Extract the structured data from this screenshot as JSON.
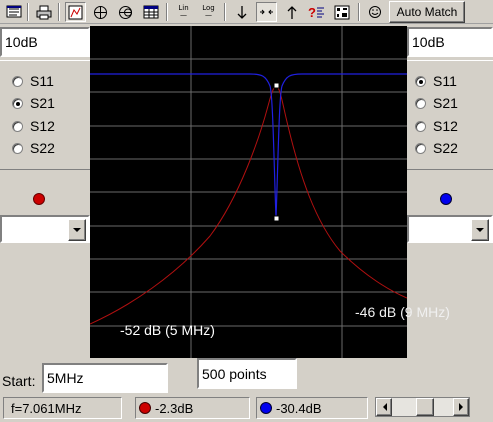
{
  "toolbar": {
    "buttons": [
      {
        "name": "open-icon"
      },
      {
        "name": "print-icon"
      },
      {
        "name": "cartesian-plot-icon"
      },
      {
        "name": "polar-plot-icon"
      },
      {
        "name": "smith-chart-icon"
      },
      {
        "name": "table-icon"
      },
      {
        "name": "linear-scale-button",
        "text": "Lin"
      },
      {
        "name": "log-scale-button",
        "text": "Log"
      },
      {
        "name": "arrow-down-icon"
      },
      {
        "name": "zoom-icon"
      },
      {
        "name": "arrow-up-icon"
      },
      {
        "name": "help-icon"
      },
      {
        "name": "tools-icon"
      },
      {
        "name": "smiley-icon"
      }
    ],
    "auto_match_label": "Auto Match"
  },
  "left_panel": {
    "scale_value": "10dB",
    "params": [
      {
        "label": "S11",
        "selected": false
      },
      {
        "label": "S21",
        "selected": true
      },
      {
        "label": "S12",
        "selected": false
      },
      {
        "label": "S22",
        "selected": false
      }
    ],
    "trace_color": "#cc0000",
    "dropdown_value": ""
  },
  "right_panel": {
    "scale_value": "10dB",
    "params": [
      {
        "label": "S11",
        "selected": true
      },
      {
        "label": "S21",
        "selected": false
      },
      {
        "label": "S12",
        "selected": false
      },
      {
        "label": "S22",
        "selected": false
      }
    ],
    "trace_color": "#0000ee",
    "dropdown_value": ""
  },
  "plot": {
    "left_annotation": "-52 dB (5 MHz)",
    "right_annotation": "-46 dB (9 MHz)",
    "background": "#000000",
    "grid_color": "#6a6a6a"
  },
  "controls": {
    "start_label": "Start:",
    "start_value": "5MHz",
    "points_value": "500 points"
  },
  "status": {
    "frequency": "f=7.061MHz",
    "red_value": "-2.3dB",
    "blue_value": "-30.4dB"
  }
}
